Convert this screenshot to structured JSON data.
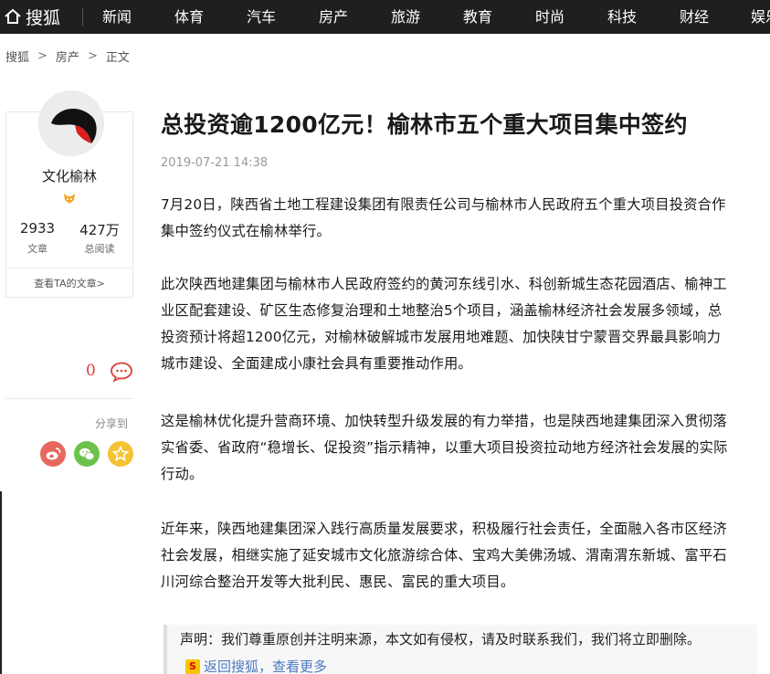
{
  "nav": {
    "logo": "搜狐",
    "items": [
      "新闻",
      "体育",
      "汽车",
      "房产",
      "旅游",
      "教育",
      "时尚",
      "科技",
      "财经",
      "娱乐"
    ]
  },
  "breadcrumb": [
    "搜狐",
    "房产",
    "正文"
  ],
  "author": {
    "name": "文化榆林",
    "articles": "2933",
    "articles_label": "文章",
    "views": "427万",
    "views_label": "总阅读",
    "link": "查看TA的文章>"
  },
  "comments": {
    "count": "0"
  },
  "share": {
    "label": "分享到",
    "buttons": [
      "weibo-icon",
      "wechat-icon",
      "favorite-icon"
    ]
  },
  "article": {
    "title": "总投资逾1200亿元！榆林市五个重大项目集中签约",
    "timestamp": "2019-07-21 14:38",
    "paragraphs": [
      [
        "7月20日，陕西省土地工程建设集团有限责任公司与榆林市人民政府五个重大项目投资合作",
        "集中签约仪式在榆林举行。"
      ],
      [
        "此次陕西地建集团与榆林市人民政府签约的黄河东线引水、科创新城生态花园酒店、榆神工",
        "业区配套建设、矿区生态修复治理和土地整治5个项目，涵盖榆林经济社会发展多领域，总",
        "投资预计将超1200亿元，对榆林破解城市发展用地难题、加快陕甘宁蒙晋交界最具影响力",
        "城市建设、全面建成小康社会具有重要推动作用。"
      ],
      [
        "这是榆林优化提升营商环境、加快转型升级发展的有力举措，也是陕西地建集团深入贯彻落",
        "实省委、省政府“稳增长、促投资”指示精神，以重大项目投资拉动地方经济社会发展的实际",
        "行动。"
      ],
      [
        "近年来，陕西地建集团深入践行高质量发展要求，积极履行社会责任，全面融入各市区经济",
        "社会发展，相继实施了延安城市文化旅游综合体、宝鸡大美佛汤城、渭南渭东新城、富平石",
        "川河综合整治开发等大批利民、惠民、富民的重大项目。"
      ]
    ],
    "notice": "声明：我们尊重原创并注明来源，本文如有侵权，请及时联系我们，我们将立即删除。",
    "back_link": "返回搜狐，查看更多"
  },
  "colors": {
    "nav_bg": "#1f1f1f",
    "accent_red": "#e03c33",
    "link_blue": "#4a7ac1"
  }
}
